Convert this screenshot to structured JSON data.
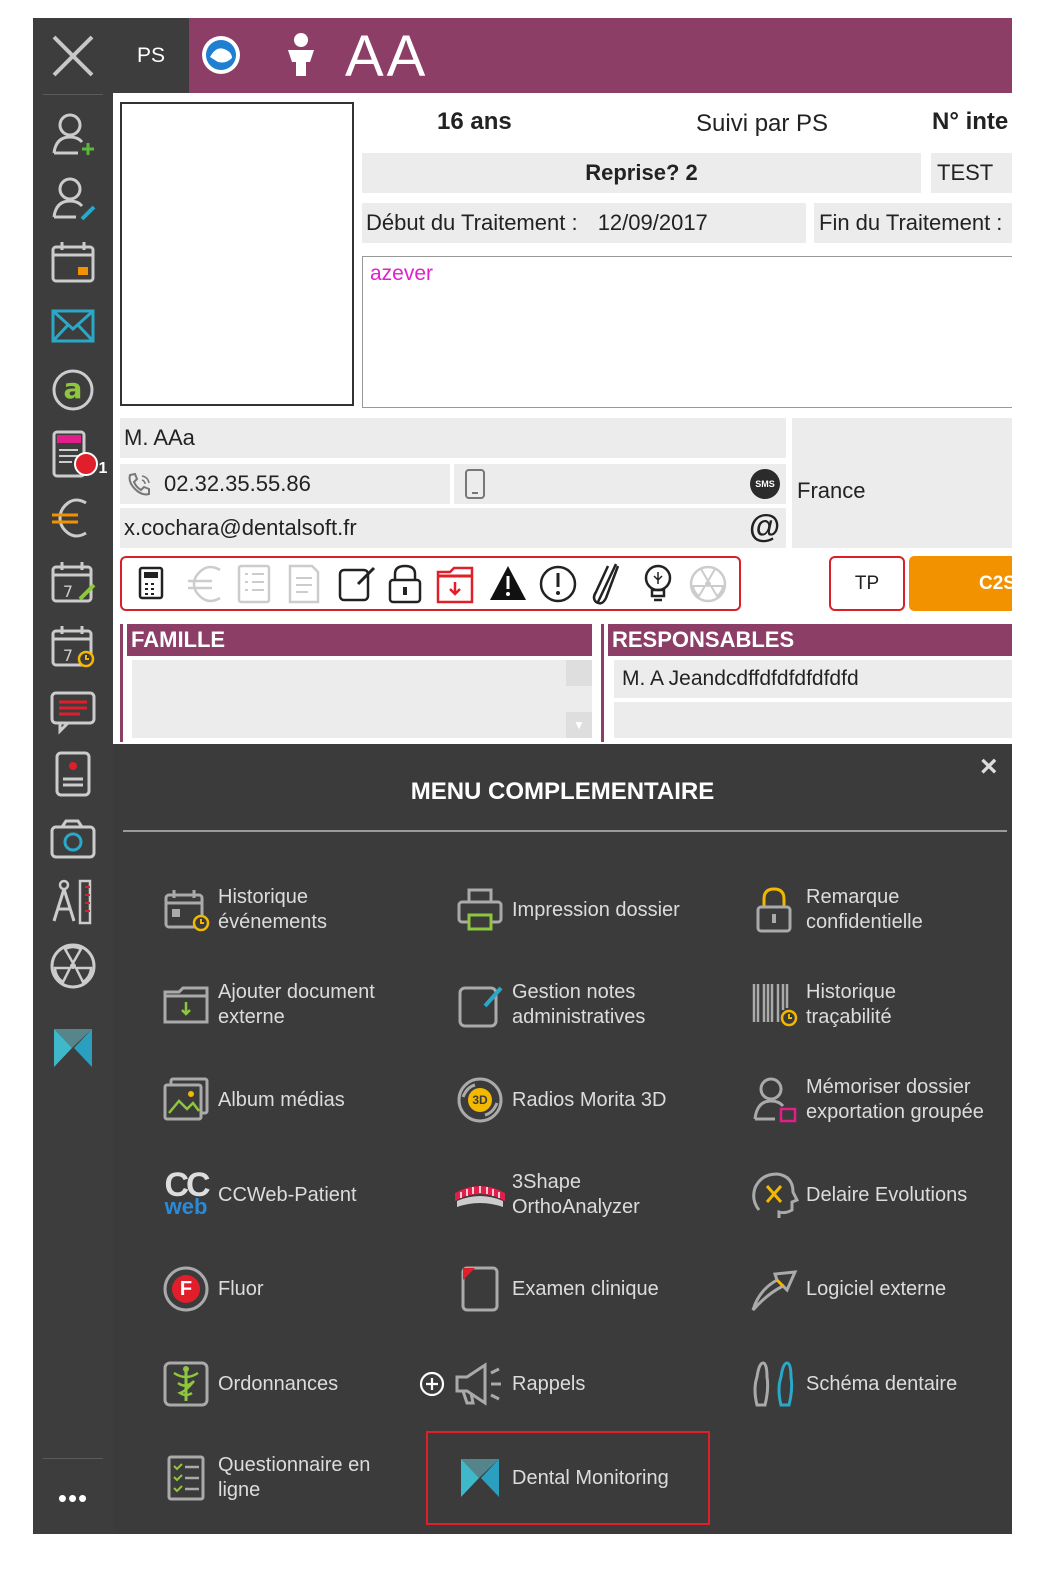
{
  "header": {
    "practitioner": "PS",
    "patient_name": "AA"
  },
  "patient": {
    "age": "16 ans",
    "followed_by": "Suivi par PS",
    "internal_number_label": "N° inte",
    "reprise": "Reprise? 2",
    "tag": "TEST",
    "treatment_start_label": "Début du Traitement :",
    "treatment_start_value": "12/09/2017",
    "treatment_end_label": "Fin du Traitement :",
    "notes": "azever",
    "contact_name": "M. AAa",
    "phone": "02.32.35.55.86",
    "email": "x.cochara@dentalsoft.fr",
    "country": "France",
    "sms_label": "SMS",
    "at_symbol": "@"
  },
  "sidebar": {
    "agenda_badge": "1",
    "more_label": "•••"
  },
  "buttons": {
    "tp": "TP",
    "c2s": "C2S"
  },
  "sections": {
    "famille": "FAMILLE",
    "responsables": "RESPONSABLES",
    "responsable_1": "M. A Jeandcdffdfdfdfdfdfd"
  },
  "menu": {
    "title": "MENU COMPLEMENTAIRE",
    "close": "×",
    "items": [
      {
        "label": "Historique\névénements",
        "icon": "calendar-clock-icon"
      },
      {
        "label": "Impression dossier",
        "icon": "printer-icon"
      },
      {
        "label": "Remarque\nconfidentielle",
        "icon": "padlock-icon"
      },
      {
        "label": "Ajouter document\nexterne",
        "icon": "folder-download-icon"
      },
      {
        "label": "Gestion notes\nadministratives",
        "icon": "note-edit-icon"
      },
      {
        "label": "Historique\ntraçabilité",
        "icon": "barcode-clock-icon"
      },
      {
        "label": "Album médias",
        "icon": "photo-album-icon"
      },
      {
        "label": "Radios Morita 3D",
        "icon": "morita-3d-icon"
      },
      {
        "label": "Mémoriser dossier\nexportation groupée",
        "icon": "user-save-icon"
      },
      {
        "label": "CCWeb-Patient",
        "icon": "ccweb-logo"
      },
      {
        "label": "3Shape\nOrthoAnalyzer",
        "icon": "dental-arch-icon"
      },
      {
        "label": "Delaire Evolutions",
        "icon": "head-profile-icon"
      },
      {
        "label": "Fluor",
        "icon": "fluor-icon"
      },
      {
        "label": "Examen clinique",
        "icon": "clinical-exam-icon"
      },
      {
        "label": "Logiciel externe",
        "icon": "external-arrow-icon"
      },
      {
        "label": "Ordonnances",
        "icon": "caduceus-icon"
      },
      {
        "label": "Rappels",
        "icon": "megaphone-icon"
      },
      {
        "label": "Schéma dentaire",
        "icon": "teeth-icon"
      },
      {
        "label": "Questionnaire en\nligne",
        "icon": "checklist-icon"
      },
      {
        "label": "Dental Monitoring",
        "icon": "dental-monitoring-icon"
      }
    ],
    "ccweb_logo_text": {
      "top": "CC",
      "bottom": "web"
    },
    "morita_badge": "3D",
    "fluor_letter": "F"
  },
  "colors": {
    "header": "#8c3e66",
    "sidebar": "#3d3d3d",
    "menu_bg": "#3b3b3b",
    "accent_orange": "#f39200",
    "highlight_red": "#e01f2a",
    "icon_teal": "#2aa8c8",
    "note_text": "#e020d0"
  }
}
